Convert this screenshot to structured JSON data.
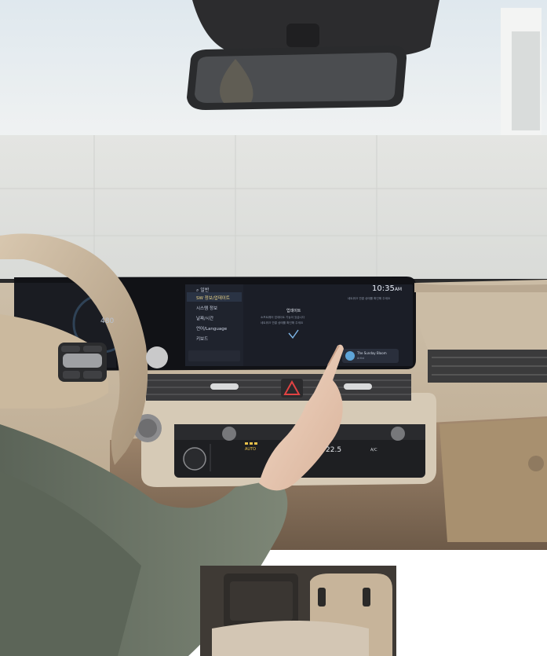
{
  "display": {
    "clock": "10:35",
    "clock_suffix": "AM",
    "breadcrumb_icon": "search-icon",
    "breadcrumb": "일반",
    "menu": [
      {
        "label": "SW 정보/업데이트",
        "selected": true
      },
      {
        "label": "시스템 정보",
        "selected": false
      },
      {
        "label": "날짜/시간",
        "selected": false
      },
      {
        "label": "언어/Language",
        "selected": false
      },
      {
        "label": "키보드",
        "selected": false
      }
    ],
    "panel_title": "업데이트",
    "panel_line_1": "소프트웨어 업데이트 기능이 있습니다",
    "panel_line_2": "네트워크 연결 상태를 확인해 주세요",
    "notification": "네트워크 연결 상태를 확인해 주세요",
    "media_title": "The Sunday Bloom",
    "media_subtitle": "Artist",
    "cluster_value": "480"
  },
  "climate": {
    "temperature": "22.5",
    "fan_label": "AUTO",
    "ac_label": "A/C"
  },
  "colors": {
    "sky": "#e9eef1",
    "wall": "#e1e3e0",
    "screen": "#1b1e27",
    "dash_beige": "#c8b8a2",
    "sleeve": "#6e7768"
  }
}
